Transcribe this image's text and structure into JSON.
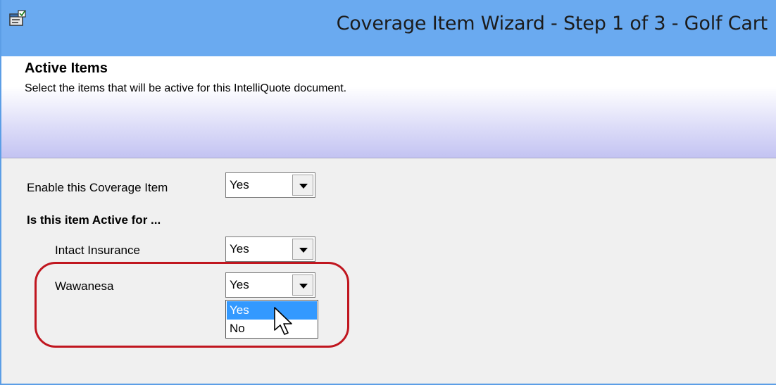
{
  "window": {
    "title": "Coverage Item Wizard - Step 1 of 3 - Golf Cart",
    "icon": "properties-icon"
  },
  "header": {
    "title": "Active Items",
    "subtitle": "Select the items that will be active for this IntelliQuote document."
  },
  "form": {
    "enable_label": "Enable this Coverage Item",
    "enable_value": "Yes",
    "section_label": "Is this item Active for ...",
    "companies": [
      {
        "label": "Intact Insurance",
        "value": "Yes"
      },
      {
        "label": "Wawanesa",
        "value": "Yes"
      }
    ],
    "dropdown_options": [
      "Yes",
      "No"
    ],
    "dropdown_selected": "Yes"
  },
  "colors": {
    "titlebar": "#6aaaf0",
    "highlight_ring": "#c0161f",
    "selection": "#3399ff"
  }
}
